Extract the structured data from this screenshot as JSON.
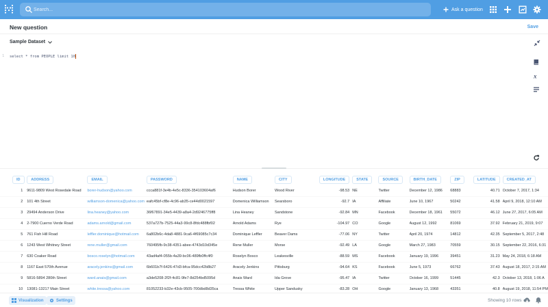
{
  "nav": {
    "search_placeholder": "Search...",
    "ask_label": "Ask a question"
  },
  "question": {
    "title": "New question",
    "save_label": "Save",
    "database": "Sample Dataset"
  },
  "editor": {
    "line_number": "1",
    "sql": "select * from PEOPLE limit 10"
  },
  "table": {
    "columns": [
      "ID",
      "ADDRESS",
      "EMAIL",
      "PASSWORD",
      "NAME",
      "CITY",
      "LONGITUDE",
      "STATE",
      "SOURCE",
      "BIRTH_DATE",
      "ZIP",
      "LATITUDE",
      "CREATED_AT"
    ],
    "rows": [
      [
        "1",
        "9611-9809 West Rosedale Road",
        "borer-hudson@yahoo.com",
        "ccca881f-3e4b-4e5c-8336-354103604af6",
        "Hudson Borer",
        "Wood River",
        "-98.53",
        "NE",
        "Twitter",
        "December 12, 1986",
        "68883",
        "40.71",
        "October 7, 2017, 1:34"
      ],
      [
        "2",
        "101 4th Street",
        "williamson-domenica@yahoo.com",
        "eafc45bf-cf8e-4c96-ab35-ce44d0021597",
        "Domenica Williamson",
        "Searsboro",
        "-92.7",
        "IA",
        "Affiliate",
        "June 10, 1967",
        "50242",
        "41.58",
        "April 9, 2018, 12:10 AM"
      ],
      [
        "3",
        "29494 Anderson Drive",
        "lina.heaney@yahoo.com",
        "36f67891-34e5-4439-a8a4-2d9246775ff8",
        "Lina Heaney",
        "Sandstone",
        "-92.84",
        "MN",
        "Facebook",
        "December 18, 1961",
        "55072",
        "46.12",
        "June 27, 2017, 6:05 AM"
      ],
      [
        "4",
        "2-7900 Cuerno Verde Road",
        "adams.arnold@gmail.com",
        "537a727b-7525-44a3-99c8-8fdc488fbf02",
        "Arnold Adams",
        "Rye",
        "-104.97",
        "CO",
        "Google",
        "August 12, 1992",
        "81069",
        "37.92",
        "February 21, 2019, 9:07"
      ],
      [
        "5",
        "761 Fish Hill Road",
        "leffler.dominique@hotmail.com",
        "6a802b6c-4da8-4881-9ca6-4f69085c7c34",
        "Dominique Leffler",
        "Beaver Dams",
        "-77.06",
        "NY",
        "Twitter",
        "April 20, 1974",
        "14812",
        "42.35",
        "September 5, 2017, 2:48"
      ],
      [
        "6",
        "1243 West Whitney Street",
        "rene.muller@gmail.com",
        "760495fb-9c38-4351-abee-4743d10d345e",
        "Rene Muller",
        "Morse",
        "-92.49",
        "LA",
        "Google",
        "March 27, 1983",
        "70559",
        "30.15",
        "September 22, 2016, 6:31"
      ],
      [
        "7",
        "630 Coaker Road",
        "bosco.roselyn@hotmail.com",
        "43ad4af4-055b-4a39-bc06-489fb0ffc4f0",
        "Roselyn Bosco",
        "Leakesville",
        "-88.59",
        "MS",
        "Facebook",
        "January 19, 1996",
        "39451",
        "31.23",
        "May 24, 2018, 6:18 AM"
      ],
      [
        "8",
        "1167 East 570th Avenue",
        "aracely.jenkins@gmail.com",
        "6b601b7f-6426-47d3-bfca-95dcc42b8b27",
        "Aracely Jenkins",
        "Pittsburg",
        "-94.64",
        "KS",
        "Facebook",
        "June 5, 1973",
        "66762",
        "37.43",
        "August 18, 2017, 2:15 AM"
      ],
      [
        "9",
        "5816-5894 280th Street",
        "ward.anais@gmail.com",
        "a3de5208-2f2f-4c81-9fe7-8d254bd5095d",
        "Anais Ward",
        "Ida Grove",
        "-95.47",
        "IA",
        "Twitter",
        "October 16, 1999",
        "51445",
        "42.3",
        "October 13, 2018, 1:06 A"
      ],
      [
        "10",
        "13081-13217 Main Street",
        "white.tressa@yahoo.com",
        "81052233-b32e-43cb-9505-700dbd8d35ca",
        "Tressa White",
        "Upper Sandusky",
        "-83.28",
        "OH",
        "Google",
        "January 13, 1968",
        "43351",
        "40.8",
        "August 19, 2018, 11:54 PM"
      ]
    ]
  },
  "footer": {
    "visualization_label": "Visualization",
    "settings_label": "Settings",
    "row_count": "Showing 10 rows"
  },
  "colors": {
    "brand": "#509ee3",
    "text": "#2e353b",
    "muted": "#74838f"
  }
}
